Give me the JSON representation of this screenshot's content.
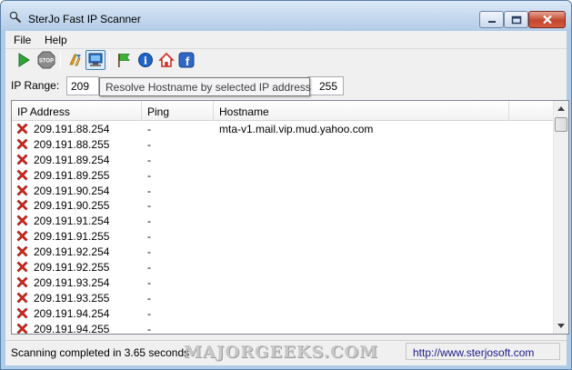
{
  "window": {
    "title": "SterJo Fast IP Scanner"
  },
  "menu": {
    "file": "File",
    "help": "Help"
  },
  "toolbar": {
    "buttons": [
      "play-icon",
      "stop-icon",
      "hosts-icon",
      "resolve-hostname-icon",
      "flag-icon",
      "info-icon",
      "home-icon",
      "facebook-icon"
    ],
    "stop_label": "STOP",
    "facebook_letter": "f",
    "info_letter": "i"
  },
  "range": {
    "label": "IP Range:",
    "start_first_octet": "209",
    "end_last_octet": "255",
    "tooltip": "Resolve Hostname by selected IP address"
  },
  "table": {
    "columns": [
      "IP Address",
      "Ping",
      "Hostname"
    ],
    "rows": [
      {
        "ip": "209.191.88.254",
        "ping": "-",
        "hostname": "mta-v1.mail.vip.mud.yahoo.com"
      },
      {
        "ip": "209.191.88.255",
        "ping": "-",
        "hostname": ""
      },
      {
        "ip": "209.191.89.254",
        "ping": "-",
        "hostname": ""
      },
      {
        "ip": "209.191.89.255",
        "ping": "-",
        "hostname": ""
      },
      {
        "ip": "209.191.90.254",
        "ping": "-",
        "hostname": ""
      },
      {
        "ip": "209.191.90.255",
        "ping": "-",
        "hostname": ""
      },
      {
        "ip": "209.191.91.254",
        "ping": "-",
        "hostname": ""
      },
      {
        "ip": "209.191.91.255",
        "ping": "-",
        "hostname": ""
      },
      {
        "ip": "209.191.92.254",
        "ping": "-",
        "hostname": ""
      },
      {
        "ip": "209.191.92.255",
        "ping": "-",
        "hostname": ""
      },
      {
        "ip": "209.191.93.254",
        "ping": "-",
        "hostname": ""
      },
      {
        "ip": "209.191.93.255",
        "ping": "-",
        "hostname": ""
      },
      {
        "ip": "209.191.94.254",
        "ping": "-",
        "hostname": ""
      },
      {
        "ip": "209.191.94.255",
        "ping": "-",
        "hostname": ""
      }
    ]
  },
  "status": {
    "message": "Scanning completed in 3.65 seconds",
    "link": "http://www.sterjosoft.com",
    "watermark": "MAJORGEEKS.COM"
  },
  "colors": {
    "status_error": "#d42a1e",
    "link": "#1a1a8c",
    "accent": "#3c7fb1"
  }
}
